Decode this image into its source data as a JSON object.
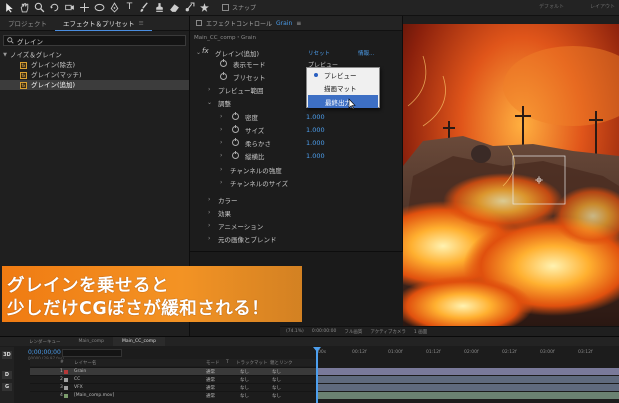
{
  "toolbar": {
    "tools": [
      "selection-arrow-icon",
      "hand-icon",
      "zoom-icon",
      "rotate-icon",
      "orbit-camera-icon",
      "pan-camera-icon",
      "rect-mask-icon",
      "pen-icon",
      "type-icon",
      "brush-icon",
      "clone-stamp-icon",
      "eraser-icon",
      "roto-brush-icon",
      "puppet-pin-icon"
    ],
    "type_glyph": "T",
    "snap_label": "スナップ",
    "right_labels": [
      "デフォルト",
      "レイアウト",
      "",
      ""
    ]
  },
  "left_panel": {
    "tabs": [
      {
        "label": "プロジェクト",
        "active": false
      },
      {
        "label": "エフェクト＆プリセット",
        "active": true
      }
    ],
    "menu_glyph": "≡",
    "search_value": "グレイン",
    "tree": {
      "category": "ノイズ＆グレイン",
      "items": [
        {
          "label": "グレイン(除去)",
          "selected": false
        },
        {
          "label": "グレイン(マッチ)",
          "selected": false
        },
        {
          "label": "グレイン(追加)",
          "selected": true
        }
      ]
    }
  },
  "effect_panel": {
    "title_prefix": "エフェクトコントロール",
    "title_layer": "Grain",
    "comp_path": "Main_CC_comp・Grain",
    "fx_glyph": "fx",
    "effect_name": "グレイン(追加)",
    "reset_label": "リセット",
    "info_label": "情報...",
    "rows": [
      {
        "label": "表示モード",
        "value": "プレビュー"
      },
      {
        "label": "ブリセット",
        "value": ""
      },
      {
        "label": "プレビュー範囲",
        "value": ""
      },
      {
        "label": "調整",
        "value": ""
      },
      {
        "label": "密度",
        "value": "1.000"
      },
      {
        "label": "サイズ",
        "value": "1.000"
      },
      {
        "label": "柔らかさ",
        "value": "1.000"
      },
      {
        "label": "縦横比",
        "value": "1.000"
      },
      {
        "label": "チャンネルの強度",
        "value": ""
      },
      {
        "label": "チャンネルのサイズ",
        "value": ""
      },
      {
        "label": "カラー",
        "value": ""
      },
      {
        "label": "効果",
        "value": ""
      },
      {
        "label": "アニメーション",
        "value": ""
      },
      {
        "label": "元の画像とブレンド",
        "value": ""
      }
    ]
  },
  "dropdown": {
    "items": [
      {
        "label": "プレビュー",
        "checked": true,
        "hover": false
      },
      {
        "label": "描画マット",
        "checked": false,
        "hover": false
      },
      {
        "label": "最終出力",
        "checked": false,
        "hover": true
      }
    ]
  },
  "viewer": {
    "status": [
      "(74.1%)",
      "0:00:00:00",
      "フル画質",
      "アクティブカメラ",
      "1 画面"
    ]
  },
  "caption": {
    "line1": "グレインを乗せると",
    "line2": "少しだけCGぽさが緩和される！"
  },
  "timeline": {
    "tabs": [
      "レンダーキュー",
      "Main_comp",
      "Main_CC_comp"
    ],
    "active_tab": 2,
    "time": "0;00;00;00",
    "fps": "00000 (29.97 fps)",
    "ruler": [
      "00s",
      "00:12f",
      "01:00f",
      "01:12f",
      "02:00f",
      "02:12f",
      "03:00f",
      "03:12f"
    ],
    "columns": [
      "#",
      "レイヤー名",
      "モード",
      "T",
      "トラックマット",
      "親とリンク"
    ],
    "layers": [
      {
        "num": "1",
        "name": "Grain",
        "mode": "通常",
        "track": "なし",
        "parent": "なし",
        "color": "#b53838",
        "bar": "#7a7a9a"
      },
      {
        "num": "2",
        "name": "CC",
        "mode": "通常",
        "track": "なし",
        "parent": "なし",
        "color": "#a0a0a0",
        "bar": "#5f6a7d"
      },
      {
        "num": "3",
        "name": "VFX",
        "mode": "通常",
        "track": "なし",
        "parent": "なし",
        "color": "#a0a0a0",
        "bar": "#5f6a7d"
      },
      {
        "num": "4",
        "name": "[Main_comp.mov]",
        "mode": "通常",
        "track": "なし",
        "parent": "なし",
        "color": "#7b9c6c",
        "bar": "#6b8272"
      }
    ],
    "badges": [
      "3D",
      "D",
      "G"
    ]
  },
  "colors": {
    "accent": "#4d9fee",
    "caption": "#f07b12",
    "highlight": "#3d6fc4"
  }
}
